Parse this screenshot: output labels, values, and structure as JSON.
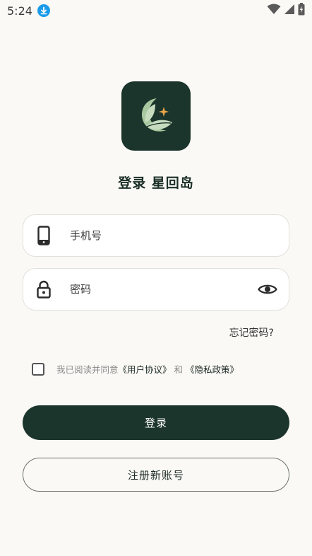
{
  "status_bar": {
    "time": "5:24",
    "icons": [
      "download-icon",
      "wifi-icon",
      "signal-icon",
      "battery-icon"
    ]
  },
  "app": {
    "logo_icon": "leaf-moon-star-logo",
    "title": "登录 星回岛"
  },
  "form": {
    "phone_placeholder": "手机号",
    "phone_value": "",
    "password_placeholder": "密码",
    "password_value": "",
    "forgot_label": "忘记密码?",
    "agreement": {
      "checked": false,
      "prefix": "我已阅读并同意",
      "user_agreement": "《用户协议》",
      "conjunction": "和",
      "privacy_policy": "《隐私政策》"
    },
    "login_label": "登录",
    "register_label": "注册新账号"
  },
  "colors": {
    "brand": "#1c352c",
    "background": "#faf9f6",
    "accent_star": "#e9a64a",
    "leaf": "#a8c9a0"
  }
}
